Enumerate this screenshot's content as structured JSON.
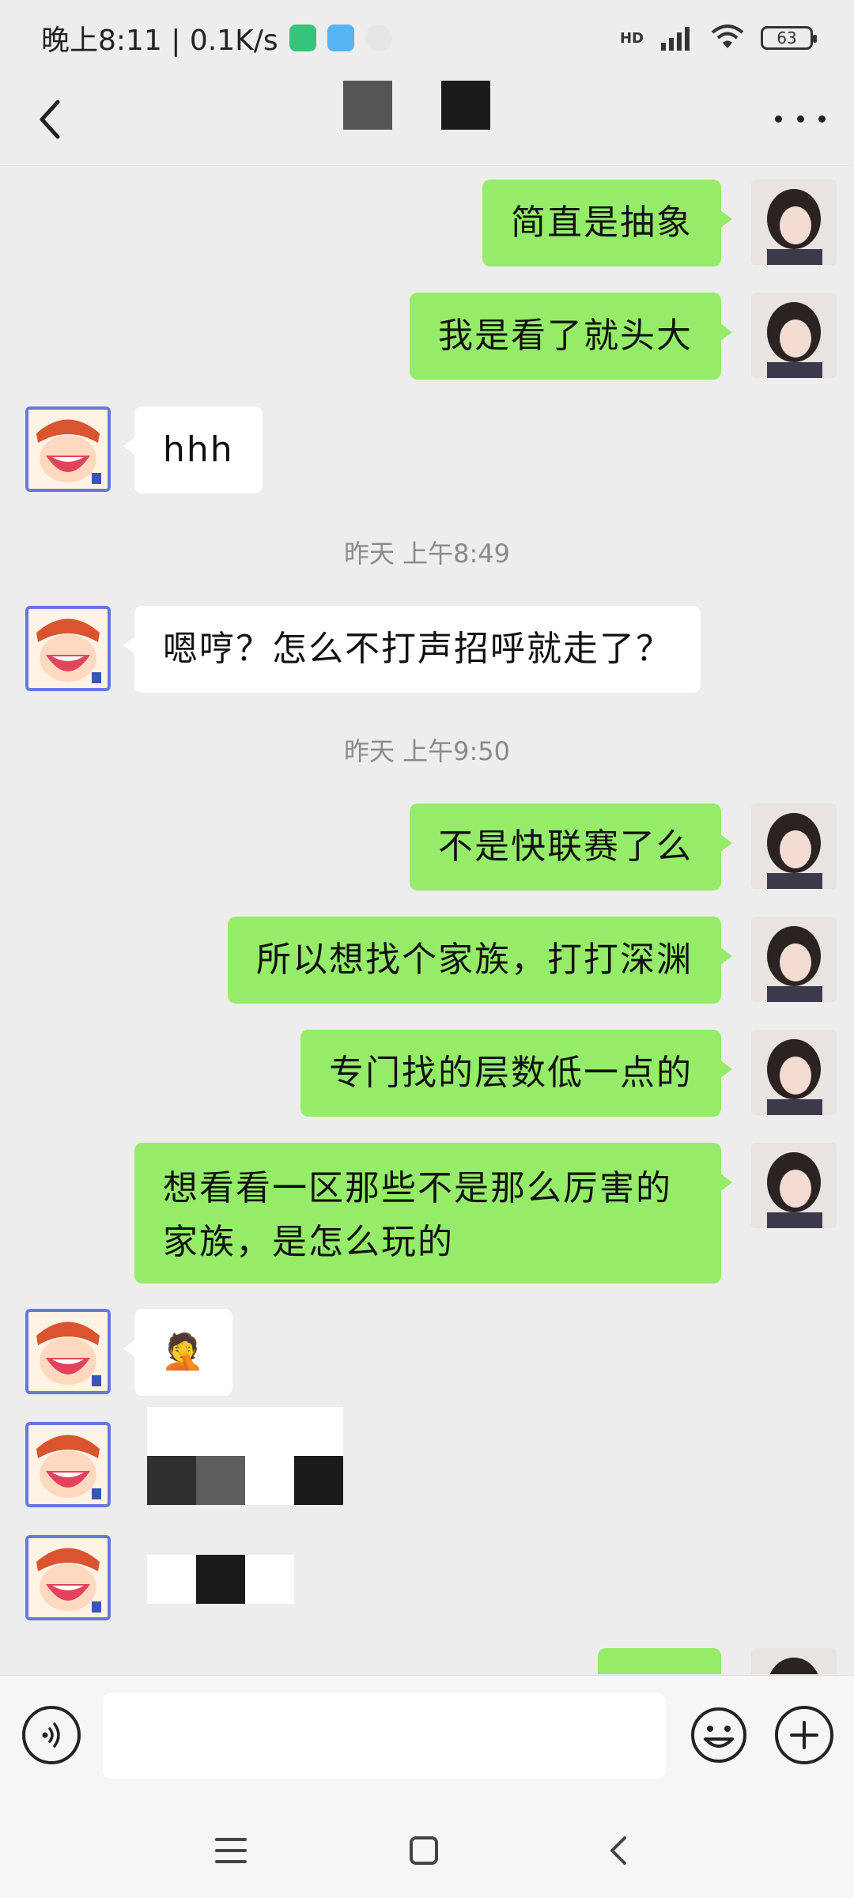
{
  "status_bar": {
    "time_speed": "晚上8:11 | 0.1K/s",
    "hd_label": "HD",
    "battery": "63"
  },
  "header": {
    "back_icon": "chevron-left-icon",
    "more_icon": "more-dots-icon"
  },
  "messages": [
    {
      "side": "me",
      "text": "简直是抽象"
    },
    {
      "side": "me",
      "text": "我是看了就头大"
    },
    {
      "side": "friend",
      "text": "hhh"
    },
    {
      "type": "time",
      "text": "昨天 上午8:49"
    },
    {
      "side": "friend",
      "text": "嗯哼？怎么不打声招呼就走了？"
    },
    {
      "type": "time",
      "text": "昨天 上午9:50"
    },
    {
      "side": "me",
      "text": "不是快联赛了么"
    },
    {
      "side": "me",
      "text": "所以想找个家族，打打深渊"
    },
    {
      "side": "me",
      "text": "专门找的层数低一点的"
    },
    {
      "side": "me",
      "text": "想看看一区那些不是那么厉害的家族，是怎么玩的"
    },
    {
      "side": "friend",
      "text": "🤦"
    }
  ],
  "input_bar": {
    "voice_icon": "voice-icon",
    "emoji_icon": "emoji-icon",
    "plus_icon": "plus-icon",
    "text_value": ""
  },
  "nav_bar": {
    "menu_icon": "menu-icon",
    "home_icon": "home-icon",
    "back_icon": "back-icon"
  },
  "colors": {
    "background": "#ededed",
    "my_bubble": "#95ec69",
    "friend_bubble": "#ffffff",
    "timestamp_text": "#8a8a8a",
    "friend_avatar_border": "#6677dd"
  }
}
